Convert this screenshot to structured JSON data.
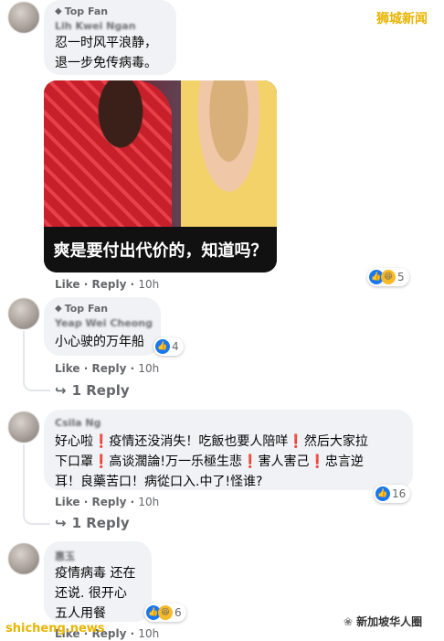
{
  "watermarks": {
    "top_right": "狮城新闻",
    "bottom_left": "shicheng.news",
    "bottom_right": "新加坡华人圈"
  },
  "media": {
    "caption": "爽是要付出代价的，知道吗？"
  },
  "comments": [
    {
      "badge": "Top Fan",
      "name": "Lih Kwei Ngan",
      "lines": [
        "忍一时风平浪静，",
        "退一步免传病毒。"
      ],
      "actions": {
        "like": "Like",
        "reply": "Reply",
        "time": "10h"
      },
      "reaction_count": "5"
    },
    {
      "badge": "Top Fan",
      "name": "Yeap Wei Cheong",
      "lines": [
        "小心驶的万年船"
      ],
      "actions": {
        "like": "Like",
        "reply": "Reply",
        "time": "10h"
      },
      "reaction_count": "4",
      "replies": "1 Reply"
    },
    {
      "name": "Csila Ng",
      "lines": [
        "好心啦❗疫情还没消失！吃飯也要人陪咩❗然后大家拉",
        "下口罩❗高谈濶論!万一乐極生悲❗害人害己❗忠言逆",
        "耳！良藥苦口！病從口入.中了!怪谁?"
      ],
      "actions": {
        "like": "Like",
        "reply": "Reply",
        "time": "10h"
      },
      "reaction_count": "16",
      "replies": "1 Reply"
    },
    {
      "name": "惠玉",
      "lines": [
        "疫情病毒 还在",
        "还说. 很开心",
        "五人用餐"
      ],
      "actions": {
        "like": "Like",
        "reply": "Reply",
        "time": "10h"
      },
      "reaction_count": "6"
    }
  ],
  "icons": {
    "badge": "badge-diamond-icon",
    "reply_arrow": "reply-arrow-icon",
    "like": "like-thumb-icon",
    "haha": "haha-emoji-icon"
  },
  "colors": {
    "bubble": "#f0f2f5",
    "like_blue": "#1877f2",
    "watermark_gold": "#e8b400",
    "meta_gray": "#65676b"
  }
}
